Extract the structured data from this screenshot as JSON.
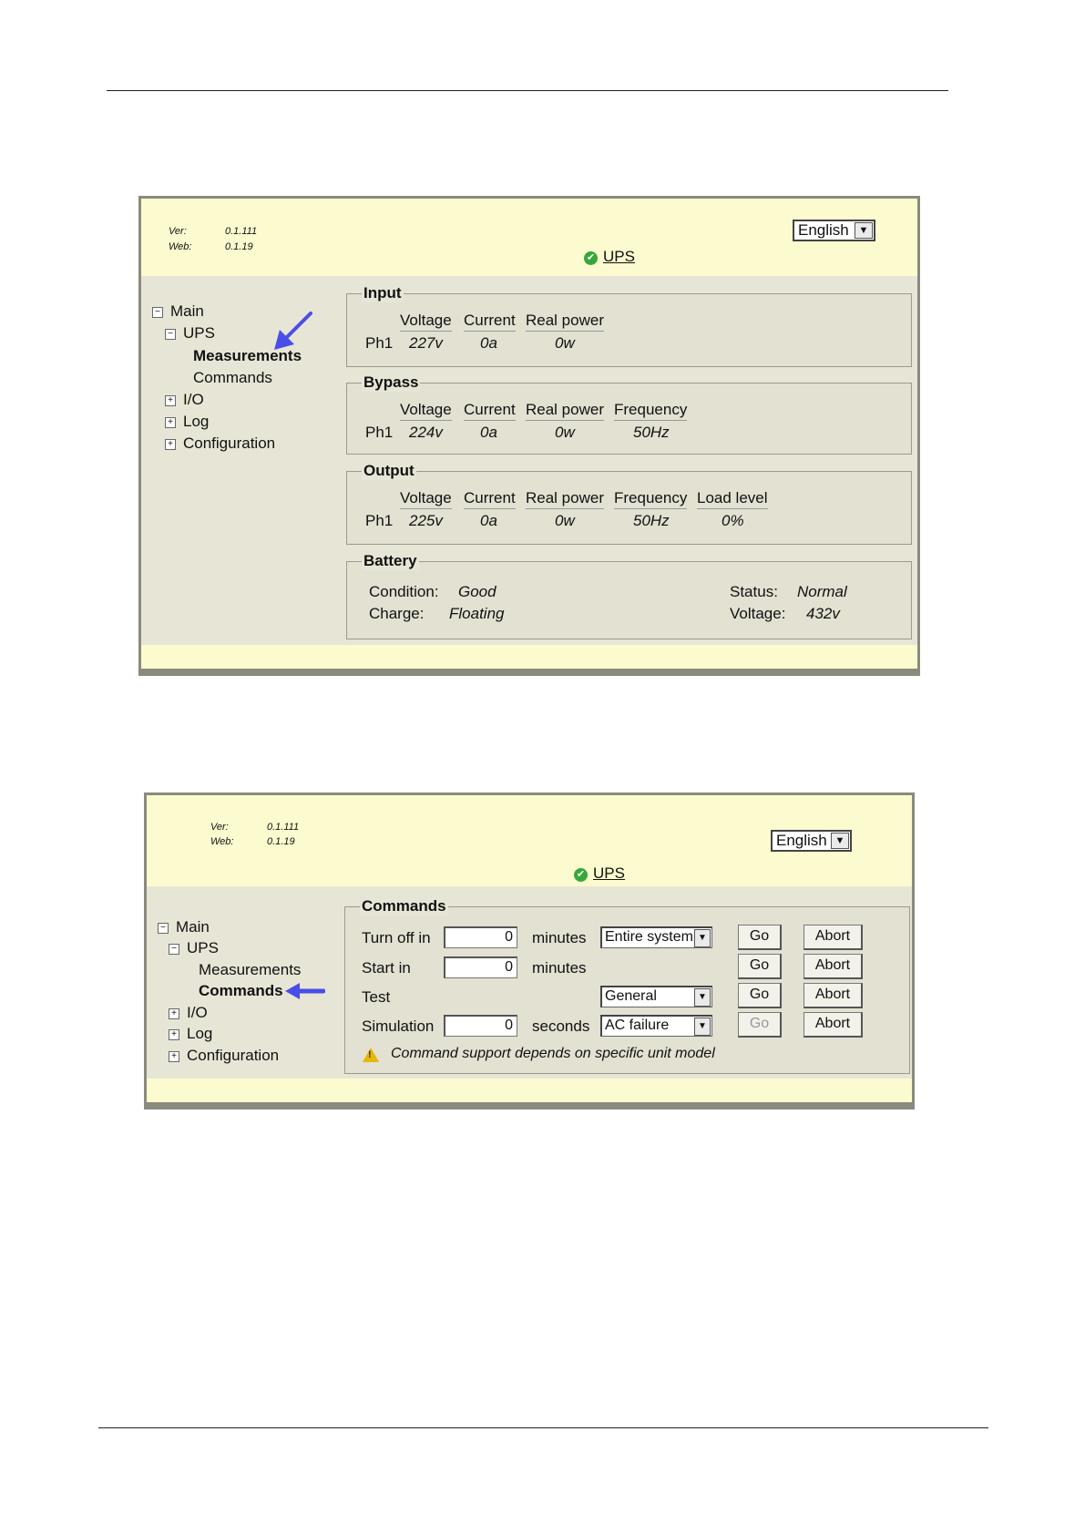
{
  "screen1": {
    "version": {
      "ver_label": "Ver:",
      "ver_value": "0.1.111",
      "web_label": "Web:",
      "web_value": "0.1.19"
    },
    "language": "English",
    "title": "UPS",
    "tree": {
      "main": "Main",
      "ups": "UPS",
      "measurements": "Measurements",
      "commands": "Commands",
      "io": "I/O",
      "log": "Log",
      "configuration": "Configuration"
    },
    "input": {
      "legend": "Input",
      "headers": [
        "Voltage",
        "Current",
        "Real power"
      ],
      "phase": "Ph1",
      "values": [
        "227v",
        "0a",
        "0w"
      ]
    },
    "bypass": {
      "legend": "Bypass",
      "headers": [
        "Voltage",
        "Current",
        "Real power",
        "Frequency"
      ],
      "phase": "Ph1",
      "values": [
        "224v",
        "0a",
        "0w",
        "50Hz"
      ]
    },
    "output": {
      "legend": "Output",
      "headers": [
        "Voltage",
        "Current",
        "Real power",
        "Frequency",
        "Load level"
      ],
      "phase": "Ph1",
      "values": [
        "225v",
        "0a",
        "0w",
        "50Hz",
        "0%"
      ]
    },
    "battery": {
      "legend": "Battery",
      "condition_label": "Condition:",
      "condition_value": "Good",
      "charge_label": "Charge:",
      "charge_value": "Floating",
      "status_label": "Status:",
      "status_value": "Normal",
      "voltage_label": "Voltage:",
      "voltage_value": "432v"
    }
  },
  "screen2": {
    "version": {
      "ver_label": "Ver:",
      "ver_value": "0.1.111",
      "web_label": "Web:",
      "web_value": "0.1.19"
    },
    "language": "English",
    "title": "UPS",
    "tree": {
      "main": "Main",
      "ups": "UPS",
      "measurements": "Measurements",
      "commands": "Commands",
      "io": "I/O",
      "log": "Log",
      "configuration": "Configuration"
    },
    "commands": {
      "legend": "Commands",
      "turn_off": {
        "label": "Turn off in",
        "value": "0",
        "unit": "minutes",
        "option": "Entire system",
        "go": "Go",
        "abort": "Abort"
      },
      "start": {
        "label": "Start in",
        "value": "0",
        "unit": "minutes",
        "go": "Go",
        "abort": "Abort"
      },
      "test": {
        "label": "Test",
        "option": "General",
        "go": "Go",
        "abort": "Abort"
      },
      "simulation": {
        "label": "Simulation",
        "value": "0",
        "unit": "seconds",
        "option": "AC failure",
        "go": "Go",
        "abort": "Abort"
      },
      "note": "Command support depends on specific unit model"
    }
  },
  "colors": {
    "header_band": "#fbfbcf",
    "panel": "#e7e6d6",
    "arrow": "#4a4de8",
    "ok_icon": "#36a83a",
    "warning": "#e8b800"
  }
}
